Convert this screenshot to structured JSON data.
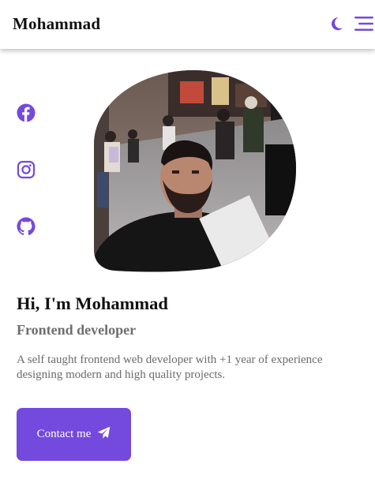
{
  "header": {
    "brand": "Mohammad",
    "icons": {
      "theme_toggle": "moon-icon",
      "menu": "hamburger-menu-icon"
    }
  },
  "social": [
    {
      "name": "Facebook",
      "icon": "facebook-icon"
    },
    {
      "name": "Instagram",
      "icon": "instagram-icon"
    },
    {
      "name": "GitHub",
      "icon": "github-icon"
    }
  ],
  "hero": {
    "title": "Hi, I'm Mohammad",
    "subtitle": "Frontend developer",
    "description": "A self taught frontend web developer with +1 year of experience designing modern and high quality projects.",
    "button_label": "Contact me",
    "button_icon": "send-icon"
  },
  "colors": {
    "accent": "#7449de",
    "subtitle": "#6e6e6e",
    "text": "#111111"
  }
}
